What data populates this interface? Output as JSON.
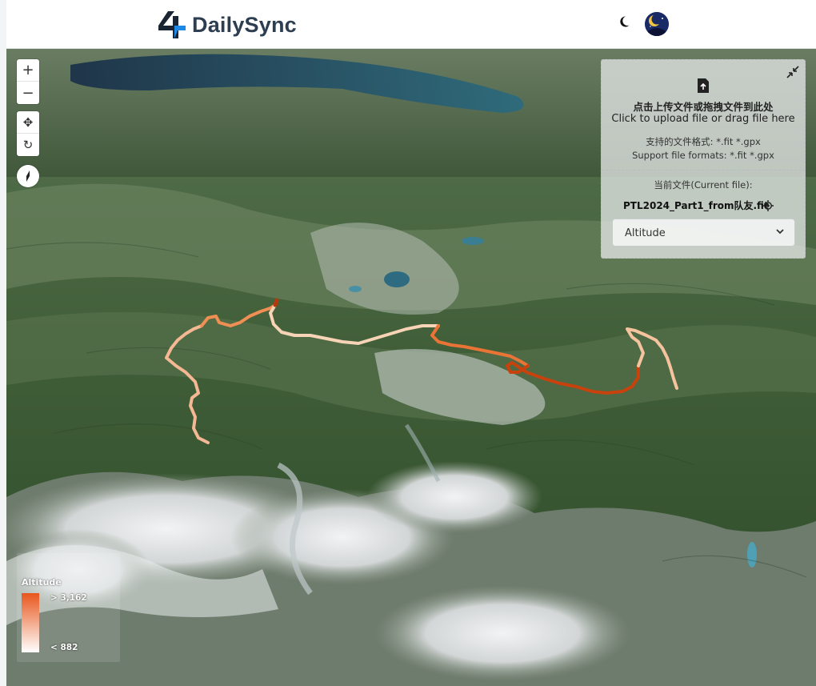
{
  "app": {
    "name": "DailySync"
  },
  "map_controls": {
    "zoom_in": "+",
    "zoom_out": "−",
    "pan": "✥",
    "rotate": "↻"
  },
  "upload_panel": {
    "title_zh": "点击上传文件或拖拽文件到此处",
    "title_en": "Click to upload file or drag file here",
    "formats_zh": "支持的文件格式: *.fit *.gpx",
    "formats_en": "Support file formats: *.fit *.gpx",
    "current_file_label": "当前文件(Current file):",
    "current_file": "PTL2024_Part1_from队友.fit",
    "metric_select": {
      "value": "Altitude",
      "options": [
        "Altitude"
      ]
    }
  },
  "legend": {
    "title": "Altitude",
    "max_label": "> 3,162",
    "min_label": "< 882",
    "color_high": "#e8561c",
    "color_low": "#ffffff"
  },
  "colors": {
    "accent": "#1e88e5",
    "brand_text": "#2d3e50",
    "route_high": "#c8420e",
    "route_low": "#fde2c8"
  }
}
